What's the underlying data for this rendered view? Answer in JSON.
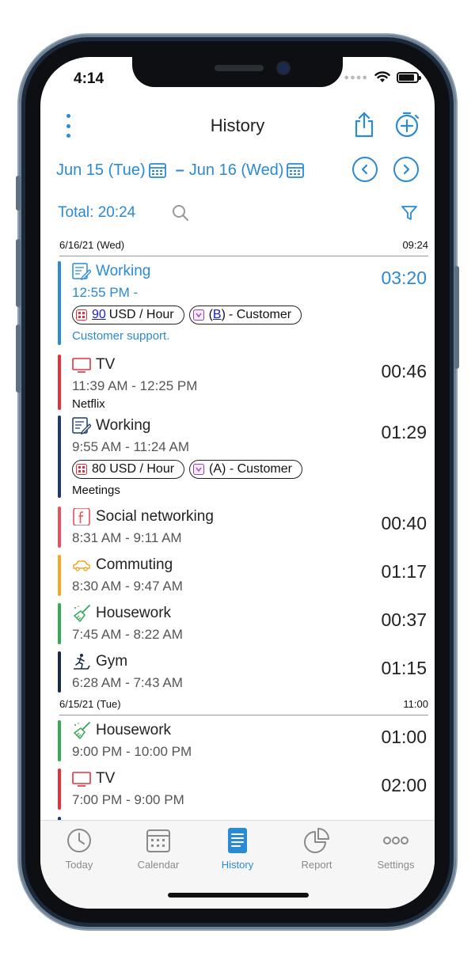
{
  "status_bar": {
    "time": "4:14"
  },
  "nav": {
    "title": "History"
  },
  "date_range": {
    "start": "Jun  15  (Tue)",
    "separator": "–",
    "end": "Jun  16  (Wed)"
  },
  "summary": {
    "total": "Total: 20:24"
  },
  "days": [
    {
      "date": "6/16/21 (Wed)",
      "total": "09:24",
      "entries": [
        {
          "name": "Working",
          "icon": "notepad-icon",
          "color": "#2a8ad4",
          "time_range": "12:55 PM -",
          "duration": "03:20",
          "active": true,
          "tags": [
            {
              "icon": "rate-icon",
              "link": "90",
              "text": "USD / Hour"
            },
            {
              "icon": "client-icon",
              "link": "B",
              "text": "- Customer",
              "paren": true
            }
          ],
          "note": "Customer support."
        },
        {
          "name": "TV",
          "icon": "tv-icon",
          "color": "#e5303c",
          "time_range": "11:39 AM - 12:25 PM",
          "duration": "00:46",
          "note": "Netflix"
        },
        {
          "name": "Working",
          "icon": "notepad-icon",
          "color": "#1d3a6e",
          "time_range": "9:55 AM - 11:24 AM",
          "duration": "01:29",
          "tags": [
            {
              "icon": "rate-icon",
              "text": "80 USD / Hour"
            },
            {
              "icon": "client-icon",
              "text": "(A) - Customer"
            }
          ],
          "note": "Meetings"
        },
        {
          "name": "Social networking",
          "icon": "facebook-icon",
          "color": "#e8505b",
          "time_range": "8:31 AM - 9:11 AM",
          "duration": "00:40"
        },
        {
          "name": "Commuting",
          "icon": "car-icon",
          "color": "#f5a623",
          "time_range": "8:30 AM - 9:47 AM",
          "duration": "01:17"
        },
        {
          "name": "Housework",
          "icon": "broom-icon",
          "color": "#34a853",
          "time_range": "7:45 AM - 8:22 AM",
          "duration": "00:37"
        },
        {
          "name": "Gym",
          "icon": "treadmill-icon",
          "color": "#1a2a4a",
          "time_range": "6:28 AM - 7:43 AM",
          "duration": "01:15"
        }
      ]
    },
    {
      "date": "6/15/21 (Tue)",
      "total": "11:00",
      "entries": [
        {
          "name": "Housework",
          "icon": "broom-icon",
          "color": "#34a853",
          "time_range": "9:00 PM - 10:00 PM",
          "duration": "01:00"
        },
        {
          "name": "TV",
          "icon": "tv-icon",
          "color": "#e5303c",
          "time_range": "7:00 PM - 9:00 PM",
          "duration": "02:00"
        }
      ]
    }
  ],
  "tabs": [
    {
      "label": "Today",
      "icon": "clock-icon"
    },
    {
      "label": "Calendar",
      "icon": "calendar-icon"
    },
    {
      "label": "History",
      "icon": "history-icon",
      "active": true
    },
    {
      "label": "Report",
      "icon": "pie-chart-icon"
    },
    {
      "label": "Settings",
      "icon": "more-icon"
    }
  ],
  "colors": {
    "accent": "#2a8ad4",
    "tab_inactive": "#8a8a8a"
  }
}
